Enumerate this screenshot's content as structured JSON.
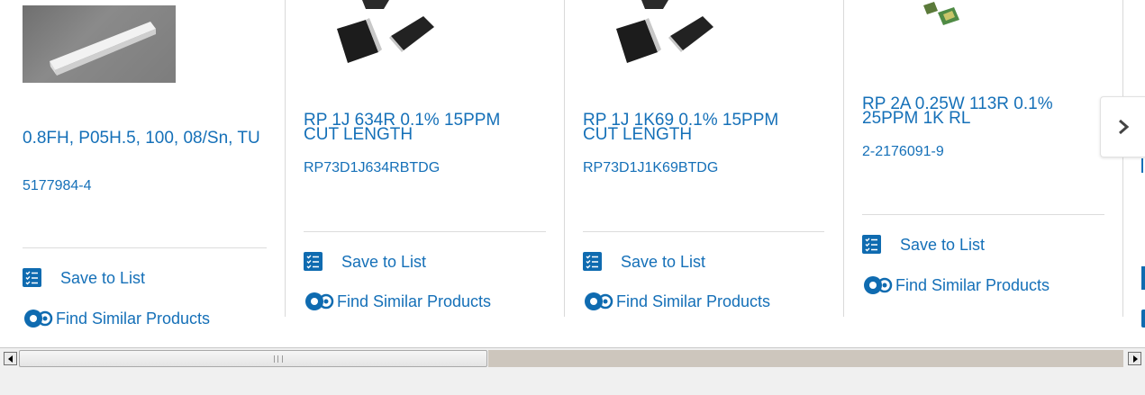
{
  "products": [
    {
      "title": "0.8FH, P05H.5, 100, 08/Sn, TU",
      "part_number": "5177984-4",
      "image": "connector-photo"
    },
    {
      "title": "RP 1J 634R 0.1% 15PPM CUT LENGTH",
      "part_number": "RP73D1J634RBTDG",
      "image": "chip-resistor-photo"
    },
    {
      "title": "RP 1J 1K69 0.1% 15PPM CUT LENGTH",
      "part_number": "RP73D1J1K69BTDG",
      "image": "chip-resistor-photo"
    },
    {
      "title": "RP 2A 0.25W 113R 0.1% 25PPM 1K RL",
      "part_number": "2-2176091-9",
      "image": "chip-resistor-photo"
    }
  ],
  "actions": {
    "save_label": "Save to List",
    "similar_label": "Find Similar Products"
  },
  "carousel": {
    "next_icon": "chevron-right-icon"
  },
  "colors": {
    "link": "#1570b8",
    "icon_bg": "#0f6bb0"
  }
}
